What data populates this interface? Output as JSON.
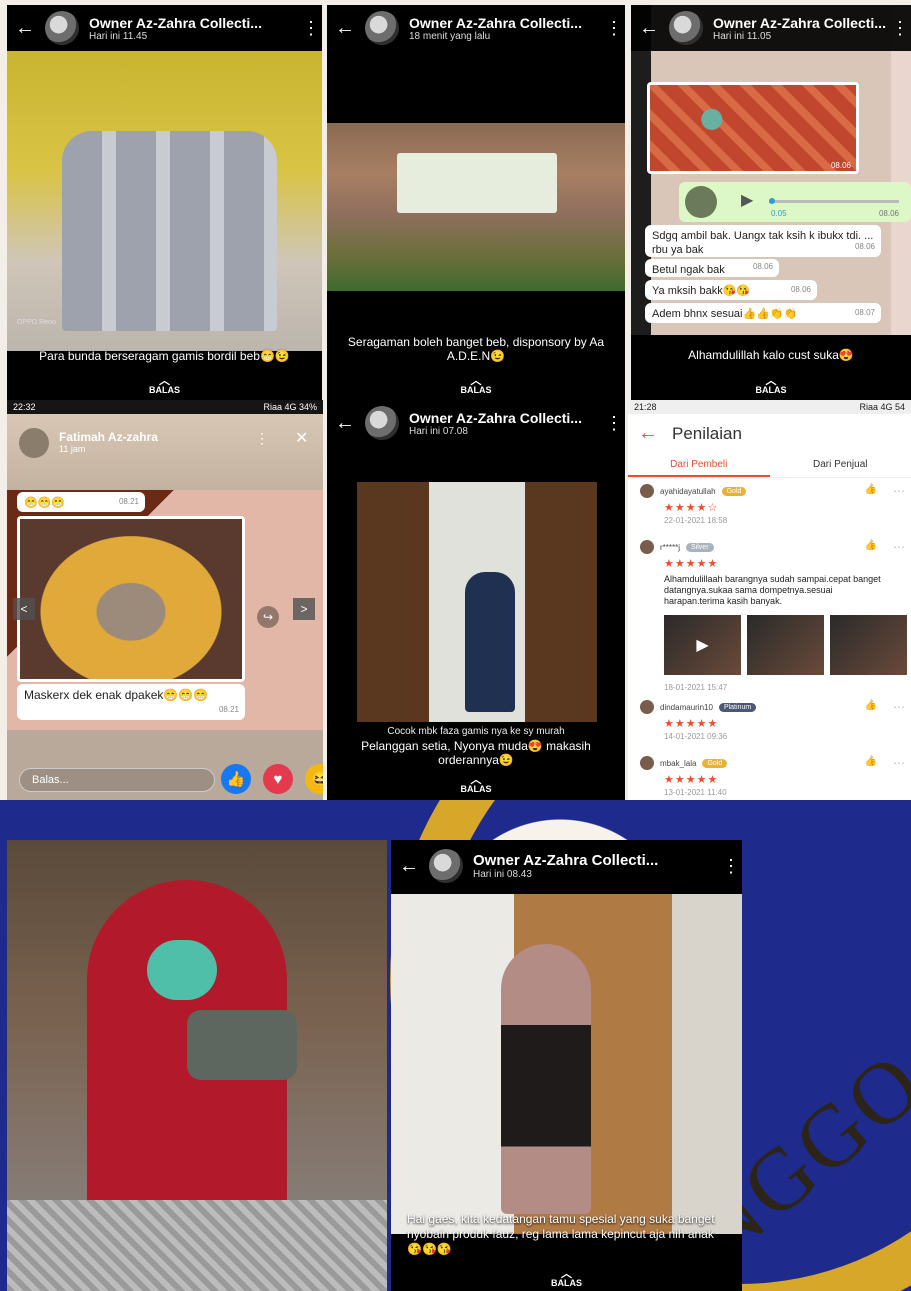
{
  "colors": {
    "accent": "#ee4d2d",
    "whatsapp_green": "#25d366",
    "dark": "#000000"
  },
  "panel1": {
    "name": "Owner Az-Zahra Collecti...",
    "time": "Hari ini 11.45",
    "caption": "Para bunda berseragam gamis bordil beb😁😉",
    "watermark": "OPPO Reno",
    "reply": "BALAS"
  },
  "panel2": {
    "name": "Owner Az-Zahra Collecti...",
    "time": "18 menit yang lalu",
    "caption": "Seragaman boleh banget beb, disponsory by Aa A.D.E.N😉",
    "reply": "BALAS"
  },
  "panel3": {
    "name": "Owner Az-Zahra Collecti...",
    "time": "Hari ini 11.05",
    "img_time": "08.06",
    "audio_time": "0.05",
    "audio_sent": "08.06",
    "messages": [
      {
        "text": "Sdgq ambil bak. Uangx tak ksih k ibukx tdi. ... rbu ya bak",
        "time": "08.06"
      },
      {
        "text": "Betul ngak bak",
        "time": "08.06"
      },
      {
        "text": "Ya mksih bakk😘😘",
        "time": "08.06"
      },
      {
        "text": "Adem bhnx sesuai👍👍👏👏",
        "time": "08.07"
      }
    ],
    "caption": "Alhamdulillah kalo cust suka😍",
    "reply": "BALAS"
  },
  "panel4": {
    "status_time": "22:32",
    "status_right": "Riaa 4G 34%",
    "name": "Fatimah Az-zahra",
    "time": "11 jam",
    "emoji_msg": "😁😁😁",
    "emoji_time": "08.21",
    "message": "Maskerx dek enak dpakek😁😁😁",
    "message_time": "08.21",
    "input_placeholder": "Balas..."
  },
  "panel5": {
    "name": "Owner Az-Zahra Collecti...",
    "time": "Hari ini 07.08",
    "overlay": "Cocok mbk faza gamis nya ke sy murah",
    "caption": "Pelanggan setia, Nyonya muda😍 makasih orderannya😉",
    "reply": "BALAS"
  },
  "panel6": {
    "status_time": "21:28",
    "status_right": "Riaa 4G 54",
    "title": "Penilaian",
    "tab_buyer": "Dari Pembeli",
    "tab_seller": "Dari Penjual",
    "reviews": [
      {
        "user": "ayahidayatullah",
        "badge": "Gold",
        "stars": "★★★★☆",
        "date": "22-01-2021 18:58"
      },
      {
        "user": "r*****j",
        "badge": "Silver",
        "stars": "★★★★★",
        "text": "Alhamdulillaah barangnya sudah sampai.cepat banget datangnya.sukaa sama dompetnya.sesuai harapan.terima kasih banyak.",
        "date": "18-01-2021 15:47"
      },
      {
        "user": "dindamaurin10",
        "badge": "Platinum",
        "stars": "★★★★★",
        "date": "14-01-2021 09:36"
      },
      {
        "user": "mbak_lala",
        "badge": "Gold",
        "stars": "★★★★★",
        "date": "13-01-2021 11:40"
      }
    ]
  },
  "panel8": {
    "name": "Owner Az-Zahra Collecti...",
    "time": "Hari ini 08.43",
    "caption": "Hai gaes, kita kedatangan tamu spesial yang suka banget nyobain produk fauz, reg lama lama kepincut aja nih anak😘😘😘",
    "reply": "BALAS"
  },
  "background_logo_text": "NGGO"
}
